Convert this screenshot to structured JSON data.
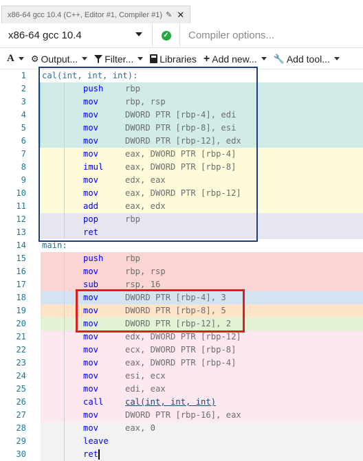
{
  "tab": {
    "title": "x86-64 gcc 10.4 (C++, Editor #1, Compiler #1)",
    "edit_icon": "pencil-icon",
    "close_icon": "close-icon"
  },
  "compiler": {
    "selected": "x86-64 gcc 10.4",
    "status": "ok",
    "options_placeholder": "Compiler options..."
  },
  "toolbar": {
    "font_label": "A",
    "output_label": "Output...",
    "filter_label": "Filter...",
    "libraries_label": "Libraries",
    "add_new_label": "Add new...",
    "add_tool_label": "Add tool..."
  },
  "colors": {
    "func1_prologue": "#d1ebe8",
    "func1_body": "#fdfbd9",
    "func1_epilogue": "#e8e5f1",
    "main_prologue": "#fbd5d1",
    "main_store1": "#d3e3f0",
    "main_store2": "#fde3c8",
    "main_store3": "#e3f2d4",
    "main_body": "#fde8ef",
    "main_tail": "#f2f2f2",
    "blue_box": "#1f3d7a",
    "red_box": "#e21c1c"
  },
  "lines": [
    {
      "n": "1",
      "kind": "label",
      "text": "cal(int, int, int):",
      "bg": "#ffffff"
    },
    {
      "n": "2",
      "kind": "ins",
      "mn": "push",
      "ops": "rbp",
      "bg": "#d1ebe8",
      "mark": "#9ccfca"
    },
    {
      "n": "3",
      "kind": "ins",
      "mn": "mov",
      "ops": "rbp, rsp",
      "bg": "#d1ebe8",
      "mark": "#9ccfca"
    },
    {
      "n": "4",
      "kind": "ins",
      "mn": "mov",
      "ops": "DWORD PTR [rbp-4], edi",
      "bg": "#d1ebe8",
      "mark": "#9ccfca"
    },
    {
      "n": "5",
      "kind": "ins",
      "mn": "mov",
      "ops": "DWORD PTR [rbp-8], esi",
      "bg": "#d1ebe8",
      "mark": "#9ccfca"
    },
    {
      "n": "6",
      "kind": "ins",
      "mn": "mov",
      "ops": "DWORD PTR [rbp-12], edx",
      "bg": "#d1ebe8",
      "mark": "#9ccfca"
    },
    {
      "n": "7",
      "kind": "ins",
      "mn": "mov",
      "ops": "eax, DWORD PTR [rbp-4]",
      "bg": "#fdfbd9"
    },
    {
      "n": "8",
      "kind": "ins",
      "mn": "imul",
      "ops": "eax, DWORD PTR [rbp-8]",
      "bg": "#fdfbd9"
    },
    {
      "n": "9",
      "kind": "ins",
      "mn": "mov",
      "ops": "edx, eax",
      "bg": "#fdfbd9"
    },
    {
      "n": "10",
      "kind": "ins",
      "mn": "mov",
      "ops": "eax, DWORD PTR [rbp-12]",
      "bg": "#fdfbd9"
    },
    {
      "n": "11",
      "kind": "ins",
      "mn": "add",
      "ops": "eax, edx",
      "bg": "#fdfbd9"
    },
    {
      "n": "12",
      "kind": "ins",
      "mn": "pop",
      "ops": "rbp",
      "bg": "#e8e5f1"
    },
    {
      "n": "13",
      "kind": "ins",
      "mn": "ret",
      "ops": "",
      "bg": "#e8e5f1"
    },
    {
      "n": "14",
      "kind": "label",
      "text": "main:",
      "bg": "#ffffff"
    },
    {
      "n": "15",
      "kind": "ins",
      "mn": "push",
      "ops": "rbp",
      "bg": "#fbd5d1"
    },
    {
      "n": "16",
      "kind": "ins",
      "mn": "mov",
      "ops": "rbp, rsp",
      "bg": "#fbd5d1"
    },
    {
      "n": "17",
      "kind": "ins",
      "mn": "sub",
      "ops": "rsp, 16",
      "bg": "#fbd5d1"
    },
    {
      "n": "18",
      "kind": "ins",
      "mn": "mov",
      "ops": "DWORD PTR [rbp-4], 3",
      "bg": "#d3e3f0"
    },
    {
      "n": "19",
      "kind": "ins",
      "mn": "mov",
      "ops": "DWORD PTR [rbp-8], 5",
      "bg": "#fde3c8"
    },
    {
      "n": "20",
      "kind": "ins",
      "mn": "mov",
      "ops": "DWORD PTR [rbp-12], 2",
      "bg": "#e3f2d4"
    },
    {
      "n": "21",
      "kind": "ins",
      "mn": "mov",
      "ops": "edx, DWORD PTR [rbp-12]",
      "bg": "#fde8ef"
    },
    {
      "n": "22",
      "kind": "ins",
      "mn": "mov",
      "ops": "ecx, DWORD PTR [rbp-8]",
      "bg": "#fde8ef"
    },
    {
      "n": "23",
      "kind": "ins",
      "mn": "mov",
      "ops": "eax, DWORD PTR [rbp-4]",
      "bg": "#fde8ef"
    },
    {
      "n": "24",
      "kind": "ins",
      "mn": "mov",
      "ops": "esi, ecx",
      "bg": "#fde8ef"
    },
    {
      "n": "25",
      "kind": "ins",
      "mn": "mov",
      "ops": "edi, eax",
      "bg": "#fde8ef"
    },
    {
      "n": "26",
      "kind": "ins",
      "mn": "call",
      "ops": "cal(int, int, int)",
      "link": true,
      "bg": "#fde8ef"
    },
    {
      "n": "27",
      "kind": "ins",
      "mn": "mov",
      "ops": "DWORD PTR [rbp-16], eax",
      "bg": "#fde8ef"
    },
    {
      "n": "28",
      "kind": "ins",
      "mn": "mov",
      "ops": "eax, 0",
      "bg": "#f2f2f2"
    },
    {
      "n": "29",
      "kind": "ins",
      "mn": "leave",
      "ops": "",
      "bg": "#f2f2f2"
    },
    {
      "n": "30",
      "kind": "ins",
      "mn": "ret",
      "ops": "",
      "bg": "#f2f2f2",
      "cursor": true
    }
  ]
}
